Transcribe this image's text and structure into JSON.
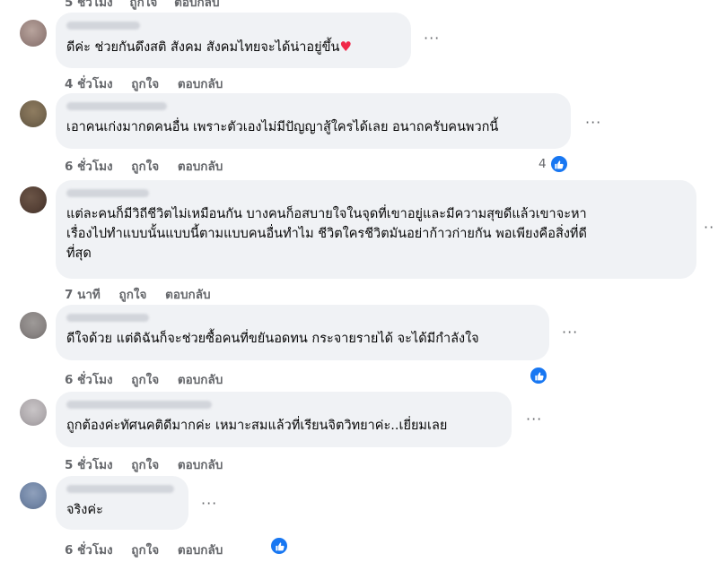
{
  "top_partial": {
    "time": "5 ชั่วโมง",
    "like": "ถูกใจ",
    "reply": "ตอบกลับ"
  },
  "comments": [
    {
      "text": "ดีค่ะ ช่วยกันดึงสติ สังคม สังคมไทยจะได้น่าอยู่ขึ้น",
      "emoji": "♥",
      "time": "4 ชั่วโมง",
      "like": "ถูกใจ",
      "reply": "ตอบกลับ",
      "more": "···"
    },
    {
      "text": "เอาคนเก่งมากดคนอื่น เพราะตัวเองไม่มีปัญญาสู้ใครได้เลย อนาถครับคนพวกนี้",
      "time": "6 ชั่วโมง",
      "like": "ถูกใจ",
      "reply": "ตอบกลับ",
      "reaction_count": "4",
      "more": "···"
    },
    {
      "text_lines": [
        "แต่ละคนก็มีวิถีชีวิตไม่เหมือนกัน บางคนก็อสบายใจในจุดที่เขาอยู่และมีความสุขดีแล้วเขาจะหา",
        "เรื่องไปทำแบบนั้นแบบนี้ตามแบบคนอื่นทำไม ชีวิตใครชีวิตมันอย่าก้าวก่ายกัน พอเพียงคือสิ่งที่ดี",
        "ที่สุด"
      ],
      "time": "7 นาที",
      "like": "ถูกใจ",
      "reply": "ตอบกลับ",
      "more": "··"
    },
    {
      "text": "ดีใจด้วย แต่ดิฉันก็จะช่วยซื้อคนที่ขยันอดทน กระจายรายได้ จะได้มีกำลังใจ",
      "time": "6 ชั่วโมง",
      "like": "ถูกใจ",
      "reply": "ตอบกลับ",
      "more": "···"
    },
    {
      "text": "ถูกต้องค่ะทัศนคติดีมากค่ะ เหมาะสมแล้วที่เรียนจิตวิทยาค่ะ..เยี่ยมเลย",
      "time": "5 ชั่วโมง",
      "like": "ถูกใจ",
      "reply": "ตอบกลับ",
      "more": "···"
    },
    {
      "text": "จริงค่ะ",
      "time": "6 ชั่วโมง",
      "like": "ถูกใจ",
      "reply": "ตอบกลับ",
      "more": "···"
    }
  ],
  "colors": {
    "bubble": "#f0f2f5",
    "meta": "#65676b",
    "like_blue": "#1877f2",
    "heart": "#f02849"
  }
}
